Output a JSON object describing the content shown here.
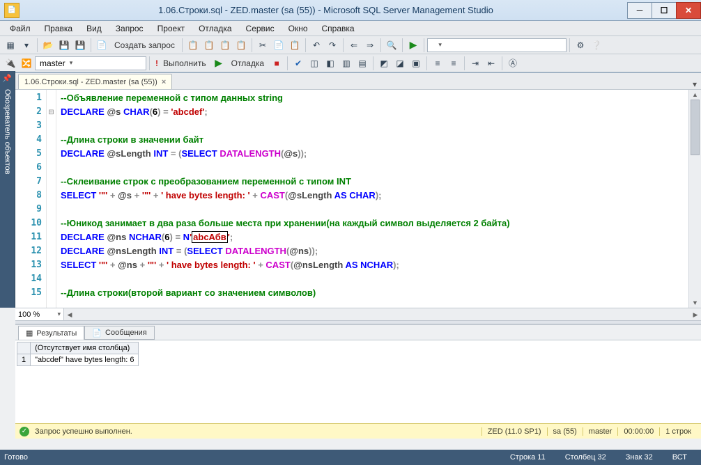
{
  "window": {
    "title": "1.06.Строки.sql - ZED.master (sa (55)) - Microsoft SQL Server Management Studio"
  },
  "menu": {
    "items": [
      "Файл",
      "Правка",
      "Вид",
      "Запрос",
      "Проект",
      "Отладка",
      "Сервис",
      "Окно",
      "Справка"
    ]
  },
  "toolbar1": {
    "new_query": "Создать запрос"
  },
  "toolbar2": {
    "db": "master",
    "execute": "Выполнить",
    "debug": "Отладка"
  },
  "side_tab": {
    "label": "Обозреватель объектов"
  },
  "doc_tab": {
    "label": "1.06.Строки.sql - ZED.master (sa (55))"
  },
  "code": {
    "lines": [
      {
        "n": "1",
        "html": "<span class='tok-cmt'>--Объявление переменной с типом данных string</span>"
      },
      {
        "n": "2",
        "html": "<span class='tok-kw'>DECLARE</span> <span class='tok-var'>@s</span> <span class='tok-kw'>CHAR</span><span class='tok-op'>(</span>6<span class='tok-op'>)</span> <span class='tok-op'>=</span> <span class='tok-str'>'abcdef'</span><span class='tok-op'>;</span>"
      },
      {
        "n": "3",
        "html": ""
      },
      {
        "n": "4",
        "html": "<span class='tok-cmt'>--Длина строки в значении байт</span>"
      },
      {
        "n": "5",
        "html": "<span class='tok-kw'>DECLARE</span> <span class='tok-var'>@sLength</span> <span class='tok-kw'>INT</span> <span class='tok-op'>=</span> <span class='tok-op'>(</span><span class='tok-kw'>SELECT</span> <span class='tok-fn'>DATALENGTH</span><span class='tok-op'>(</span><span class='tok-var'>@s</span><span class='tok-op'>));</span>"
      },
      {
        "n": "6",
        "html": ""
      },
      {
        "n": "7",
        "html": "<span class='tok-cmt'>--Склеивание строк с преобразованием переменной с типом INT</span>"
      },
      {
        "n": "8",
        "html": "<span class='tok-kw'>SELECT</span> <span class='tok-str'>'\"'</span> <span class='tok-op'>+</span> <span class='tok-var'>@s</span> <span class='tok-op'>+</span> <span class='tok-str'>'\"'</span> <span class='tok-op'>+</span> <span class='tok-str'>' have bytes length: '</span> <span class='tok-op'>+</span> <span class='tok-fn'>CAST</span><span class='tok-op'>(</span><span class='tok-var'>@sLength</span> <span class='tok-kw'>AS</span> <span class='tok-kw'>CHAR</span><span class='tok-op'>);</span>"
      },
      {
        "n": "9",
        "html": ""
      },
      {
        "n": "10",
        "html": "<span class='tok-cmt'>--Юникод занимает в два раза больше места при хранении(на каждый символ выделяется 2 байта)</span>"
      },
      {
        "n": "11",
        "html": "<span class='tok-kw'>DECLARE</span> <span class='tok-var'>@ns</span> <span class='tok-kw'>NCHAR</span><span class='tok-op'>(</span>6<span class='tok-op'>)</span> <span class='tok-op'>=</span> <span class='tok-kw'>N</span><span class='tok-str'>'<span class='caret'>abcАбв</span>'</span><span class='tok-op'>;</span>"
      },
      {
        "n": "12",
        "html": "<span class='tok-kw'>DECLARE</span> <span class='tok-var'>@nsLength</span> <span class='tok-kw'>INT</span> <span class='tok-op'>=</span> <span class='tok-op'>(</span><span class='tok-kw'>SELECT</span> <span class='tok-fn'>DATALENGTH</span><span class='tok-op'>(</span><span class='tok-var'>@ns</span><span class='tok-op'>));</span>"
      },
      {
        "n": "13",
        "html": "<span class='tok-kw'>SELECT</span> <span class='tok-str'>'\"'</span> <span class='tok-op'>+</span> <span class='tok-var'>@ns</span> <span class='tok-op'>+</span> <span class='tok-str'>'\"'</span> <span class='tok-op'>+</span> <span class='tok-str'>' have bytes length: '</span> <span class='tok-op'>+</span> <span class='tok-fn'>CAST</span><span class='tok-op'>(</span><span class='tok-var'>@nsLength</span> <span class='tok-kw'>AS</span> <span class='tok-kw'>NCHAR</span><span class='tok-op'>);</span>"
      },
      {
        "n": "14",
        "html": ""
      },
      {
        "n": "15",
        "html": "<span class='tok-cmt'>--Длина строки(второй вариант со значением символов)</span>"
      }
    ]
  },
  "zoom": {
    "value": "100 %"
  },
  "results": {
    "tabs": {
      "results": "Результаты",
      "messages": "Сообщения"
    },
    "col_header": "(Отсутствует имя столбца)",
    "row_num": "1",
    "cell": "\"abcdef\" have bytes length: 6"
  },
  "exec_status": {
    "msg": "Запрос успешно выполнен.",
    "server": "ZED (11.0 SP1)",
    "login": "sa (55)",
    "db": "master",
    "time": "00:00:00",
    "rows": "1 строк"
  },
  "statusbar": {
    "ready": "Готово",
    "line": "Строка 11",
    "col": "Столбец 32",
    "char": "Знак 32",
    "ins": "ВСТ"
  }
}
